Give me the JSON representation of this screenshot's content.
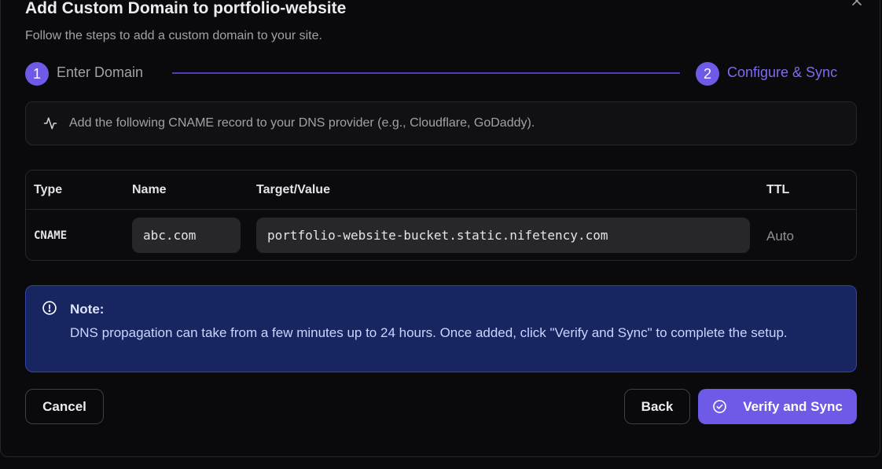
{
  "dialog": {
    "title": "Add Custom Domain to portfolio-website",
    "subtitle": "Follow the steps to add a custom domain to your site.",
    "close_icon": "x-icon"
  },
  "stepper": {
    "steps": [
      {
        "number": "1",
        "label": "Enter Domain",
        "state": "completed"
      },
      {
        "number": "2",
        "label": "Configure & Sync",
        "state": "active"
      }
    ]
  },
  "info": {
    "icon": "activity-icon",
    "message": "Add the following CNAME record to your DNS provider (e.g., Cloudflare, GoDaddy)."
  },
  "dns_table": {
    "headers": [
      "Type",
      "Name",
      "Target/Value",
      "TTL"
    ],
    "rows": [
      {
        "type": "CNAME",
        "name": "abc.com",
        "target": "portfolio-website-bucket.static.nifetency.com",
        "ttl": "Auto"
      }
    ]
  },
  "note": {
    "icon": "alert-circle-icon",
    "title": "Note:",
    "body": "DNS propagation can take from a few minutes up to 24 hours. Once added, click \"Verify and Sync\" to complete the setup."
  },
  "actions": {
    "cancel_label": "Cancel",
    "back_label": "Back",
    "verify_label": "Verify and Sync",
    "verify_icon": "check-circle-icon"
  },
  "colors": {
    "accent": "#6d5ae6",
    "note_background": "#172561",
    "background": "#0a0a0c"
  }
}
